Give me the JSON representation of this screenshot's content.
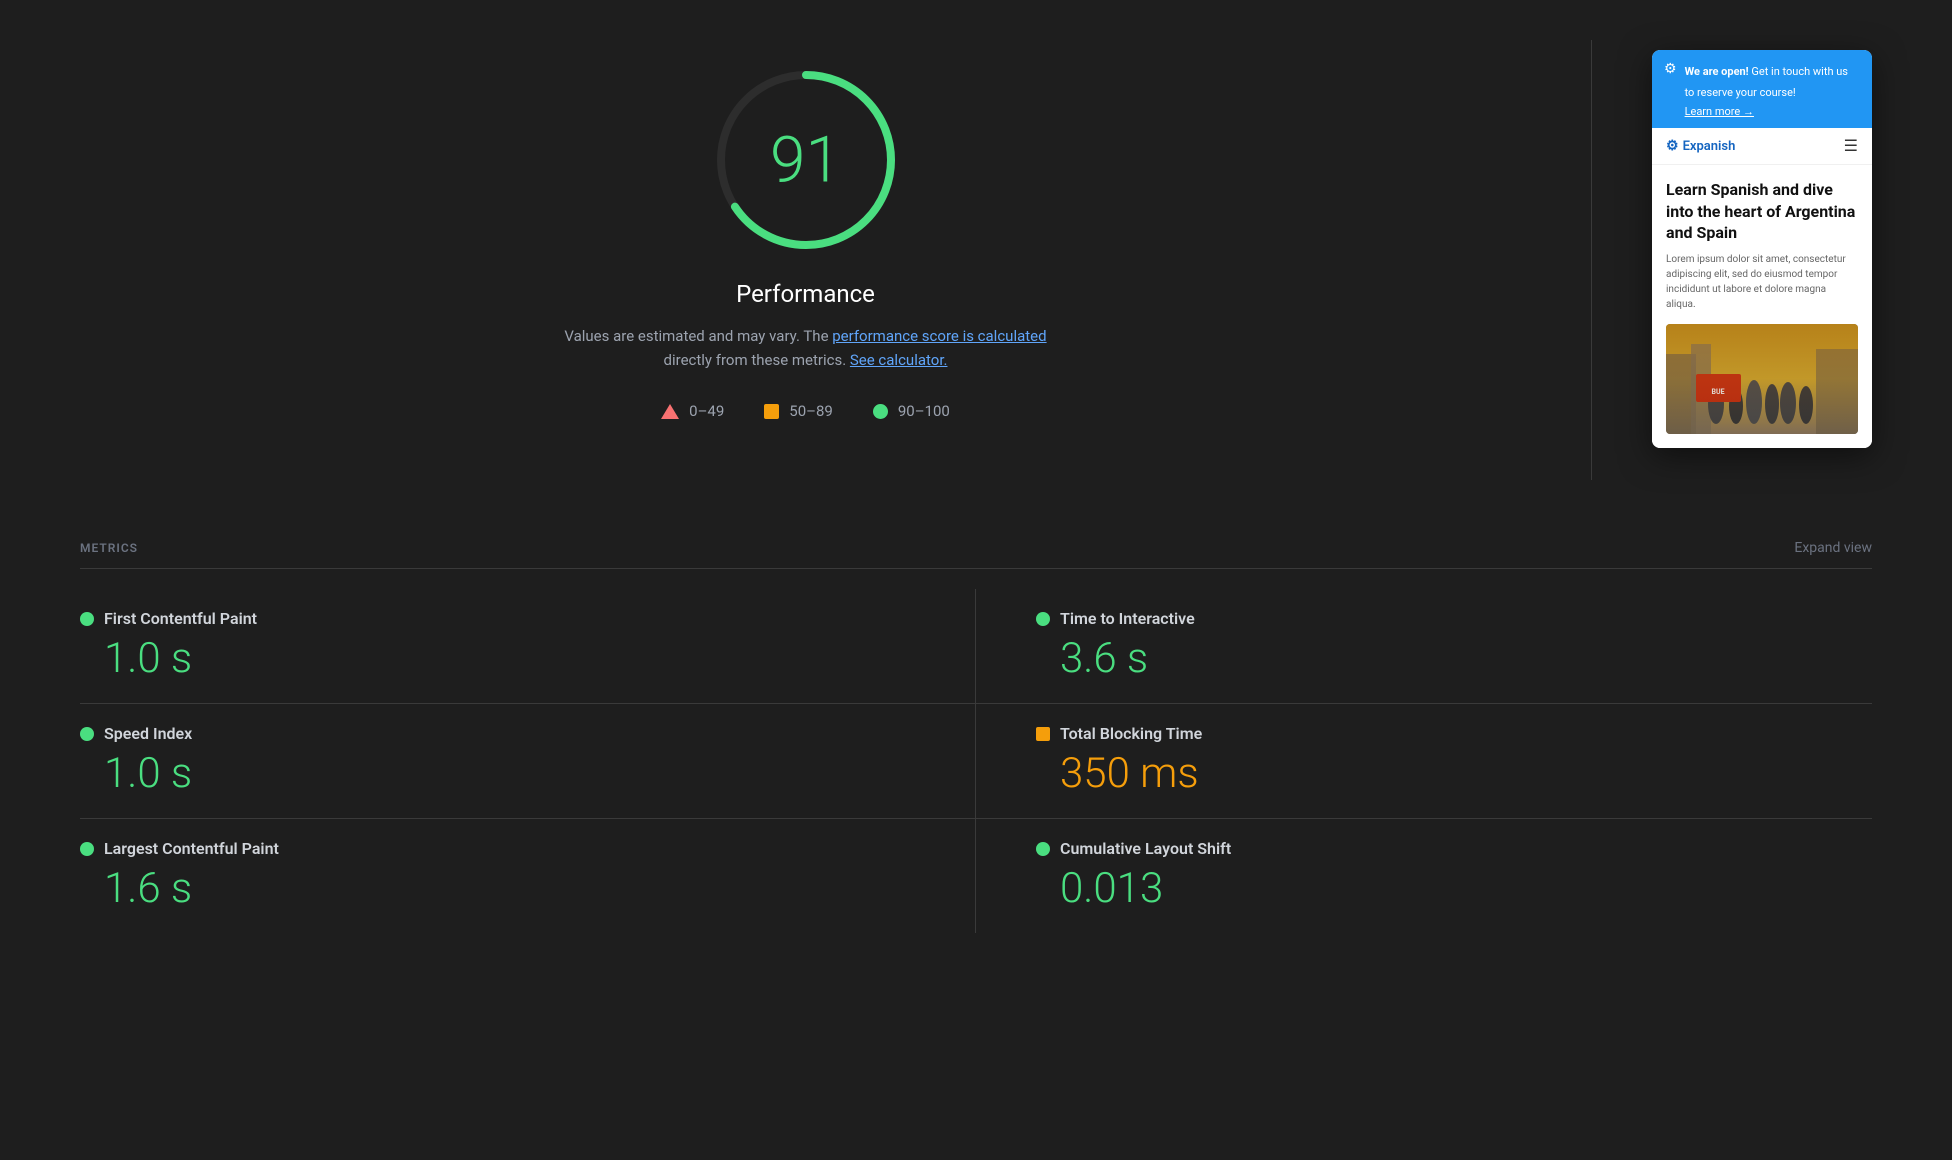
{
  "performance": {
    "score": "91",
    "title": "Performance",
    "description_prefix": "Values are estimated and may vary. The ",
    "link1_text": "performance score is calculated",
    "description_middle": " directly from these metrics. ",
    "link2_text": "See calculator.",
    "score_color": "#4ade80"
  },
  "legend": {
    "range1": "0–49",
    "range2": "50–89",
    "range3": "90–100"
  },
  "preview": {
    "banner_bold": "We are open!",
    "banner_text": " Get in touch with us to reserve your course!",
    "banner_link": "Learn more →",
    "logo_text": "Expanish",
    "heading": "Learn Spanish and dive into the heart of Argentina and Spain",
    "body_text": "Lorem ipsum dolor sit amet, consectetur adipiscing elit, sed do eiusmod tempor incididunt ut labore et dolore magna aliqua."
  },
  "metrics": {
    "section_title": "METRICS",
    "expand_label": "Expand view",
    "items": [
      {
        "name": "First Contentful Paint",
        "value": "1.0 s",
        "status": "green"
      },
      {
        "name": "Time to Interactive",
        "value": "3.6 s",
        "status": "green"
      },
      {
        "name": "Speed Index",
        "value": "1.0 s",
        "status": "green"
      },
      {
        "name": "Total Blocking Time",
        "value": "350 ms",
        "status": "orange"
      },
      {
        "name": "Largest Contentful Paint",
        "value": "1.6 s",
        "status": "green"
      },
      {
        "name": "Cumulative Layout Shift",
        "value": "0.013",
        "status": "green"
      }
    ]
  }
}
